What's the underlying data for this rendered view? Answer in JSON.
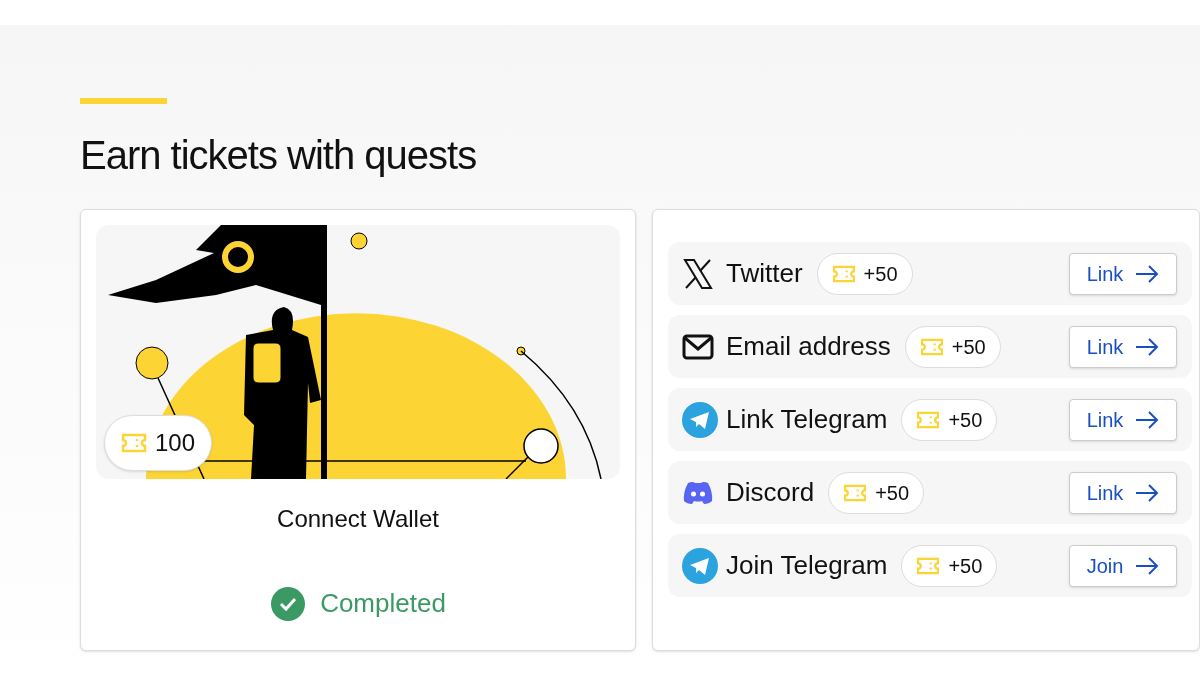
{
  "section": {
    "title": "Earn tickets with quests"
  },
  "wallet_card": {
    "reward": "100",
    "title": "Connect Wallet",
    "completed": true,
    "status": "Completed"
  },
  "quests": [
    {
      "kind": "x",
      "name": "Twitter",
      "reward": "+50",
      "button": "Link"
    },
    {
      "kind": "email",
      "name": "Email address",
      "reward": "+50",
      "button": "Link"
    },
    {
      "kind": "telegram",
      "name": "Link Telegram",
      "reward": "+50",
      "button": "Link"
    },
    {
      "kind": "discord",
      "name": "Discord",
      "reward": "+50",
      "button": "Link"
    },
    {
      "kind": "telegram",
      "name": "Join Telegram",
      "reward": "+50",
      "button": "Join"
    }
  ]
}
